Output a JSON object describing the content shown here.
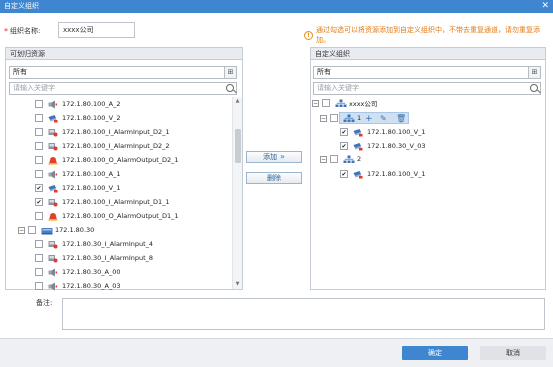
{
  "window": {
    "title": "自定义组织"
  },
  "name_field": {
    "label": "组织名称:",
    "value": "xxxx公司"
  },
  "warning": "通过勾选可以将资源添加到自定义组织中，不带去重复通道，请勿重复添加。",
  "left_panel": {
    "title": "可划归资源",
    "combo_value": "所有",
    "search_placeholder": "请输入关键字",
    "items": [
      {
        "label": "172.1.80.100_A_2",
        "icon": "audio-channel",
        "checked": false
      },
      {
        "label": "172.1.80.100_V_2",
        "icon": "camera-channel",
        "checked": false
      },
      {
        "label": "172.1.80.100_I_AlarmInput_D2_1",
        "icon": "alarm-input",
        "checked": false
      },
      {
        "label": "172.1.80.100_I_AlarmInput_D2_2",
        "icon": "alarm-input",
        "checked": false
      },
      {
        "label": "172.1.80.100_O_AlarmOutput_D2_1",
        "icon": "alarm-output",
        "checked": false
      },
      {
        "label": "172.1.80.100_A_1",
        "icon": "audio-channel",
        "checked": false
      },
      {
        "label": "172.1.80.100_V_1",
        "icon": "camera-channel",
        "checked": true
      },
      {
        "label": "172.1.80.100_I_AlarmInput_D1_1",
        "icon": "alarm-input",
        "checked": true
      },
      {
        "label": "172.1.80.100_O_AlarmOutput_D1_1",
        "icon": "alarm-output",
        "checked": false
      },
      {
        "label": "172.1.80.30",
        "icon": "device",
        "checked": false
      },
      {
        "label": "172.1.80.30_I_AlarmInput_4",
        "icon": "alarm-input",
        "checked": false
      },
      {
        "label": "172.1.80.30_I_AlarmInput_8",
        "icon": "alarm-input",
        "checked": false
      },
      {
        "label": "172.1.80.30_A_00",
        "icon": "audio-channel",
        "checked": false
      },
      {
        "label": "172.1.80.30_A_03",
        "icon": "audio-channel",
        "checked": false
      }
    ]
  },
  "buttons": {
    "add": "添加",
    "delete": "删除",
    "ok": "确定",
    "cancel": "取消"
  },
  "right_panel": {
    "title": "自定义组织",
    "combo_value": "所有",
    "search_placeholder": "请输入关键字",
    "root": "xxxx公司",
    "groups": [
      {
        "label": "1",
        "items": [
          "172.1.80.100_V_1",
          "172.1.80.30_V_03"
        ]
      },
      {
        "label": "2",
        "items": [
          "172.1.80.100_V_1"
        ]
      }
    ]
  },
  "notes": {
    "label": "备注:",
    "value": ""
  },
  "colors": {
    "primary": "#3f86d0",
    "warning": "#e07b16",
    "panel_header": "#e8ecf1"
  }
}
